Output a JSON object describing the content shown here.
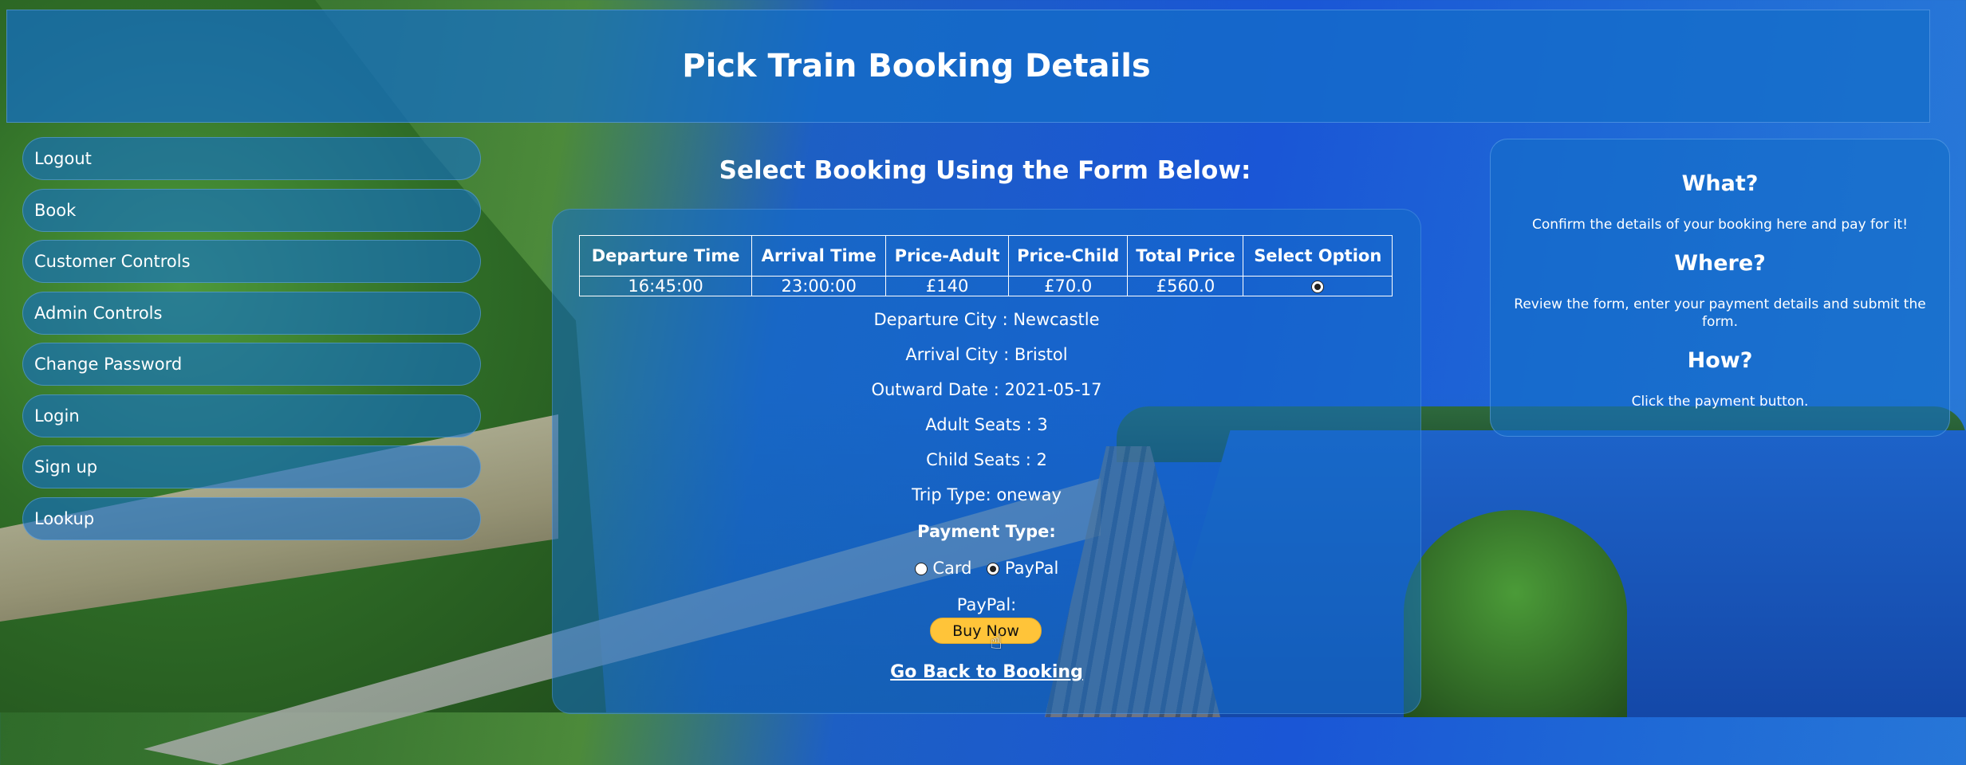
{
  "header": {
    "title": "Pick Train Booking Details"
  },
  "sidebar": {
    "items": [
      {
        "label": "Logout"
      },
      {
        "label": "Book"
      },
      {
        "label": "Customer Controls"
      },
      {
        "label": "Admin Controls"
      },
      {
        "label": "Change Password"
      },
      {
        "label": "Login"
      },
      {
        "label": "Sign up"
      },
      {
        "label": "Lookup"
      }
    ]
  },
  "main": {
    "title": "Select Booking Using the Form Below:",
    "table": {
      "headers": [
        "Departure Time",
        "Arrival Time",
        "Price-Adult",
        "Price-Child",
        "Total Price",
        "Select Option"
      ],
      "rows": [
        {
          "departure": "16:45:00",
          "arrival": "23:00:00",
          "price_adult": "£140",
          "price_child": "£70.0",
          "total": "£560.0",
          "selected": true
        }
      ]
    },
    "details": {
      "departure_city": "Departure City : Newcastle",
      "arrival_city": "Arrival City : Bristol",
      "outward_date": "Outward Date : 2021-05-17",
      "adult_seats": "Adult Seats : 3",
      "child_seats": "Child Seats : 2",
      "trip_type": "Trip Type: oneway"
    },
    "payment": {
      "heading": "Payment Type:",
      "options": [
        {
          "label": "Card",
          "selected": false
        },
        {
          "label": "PayPal",
          "selected": true
        }
      ],
      "paypal_label": "PayPal:",
      "buy_button": "Buy Now"
    },
    "back_link": "Go Back to Booking"
  },
  "info": {
    "what_heading": "What?",
    "what_text": "Confirm the details of your booking here and pay for it!",
    "where_heading": "Where?",
    "where_text": "Review the form, enter your payment details and submit the form.",
    "how_heading": "How?",
    "how_text": "Click the payment button."
  },
  "colors": {
    "panel": "#146ec8",
    "buy_button": "#ffc439"
  }
}
